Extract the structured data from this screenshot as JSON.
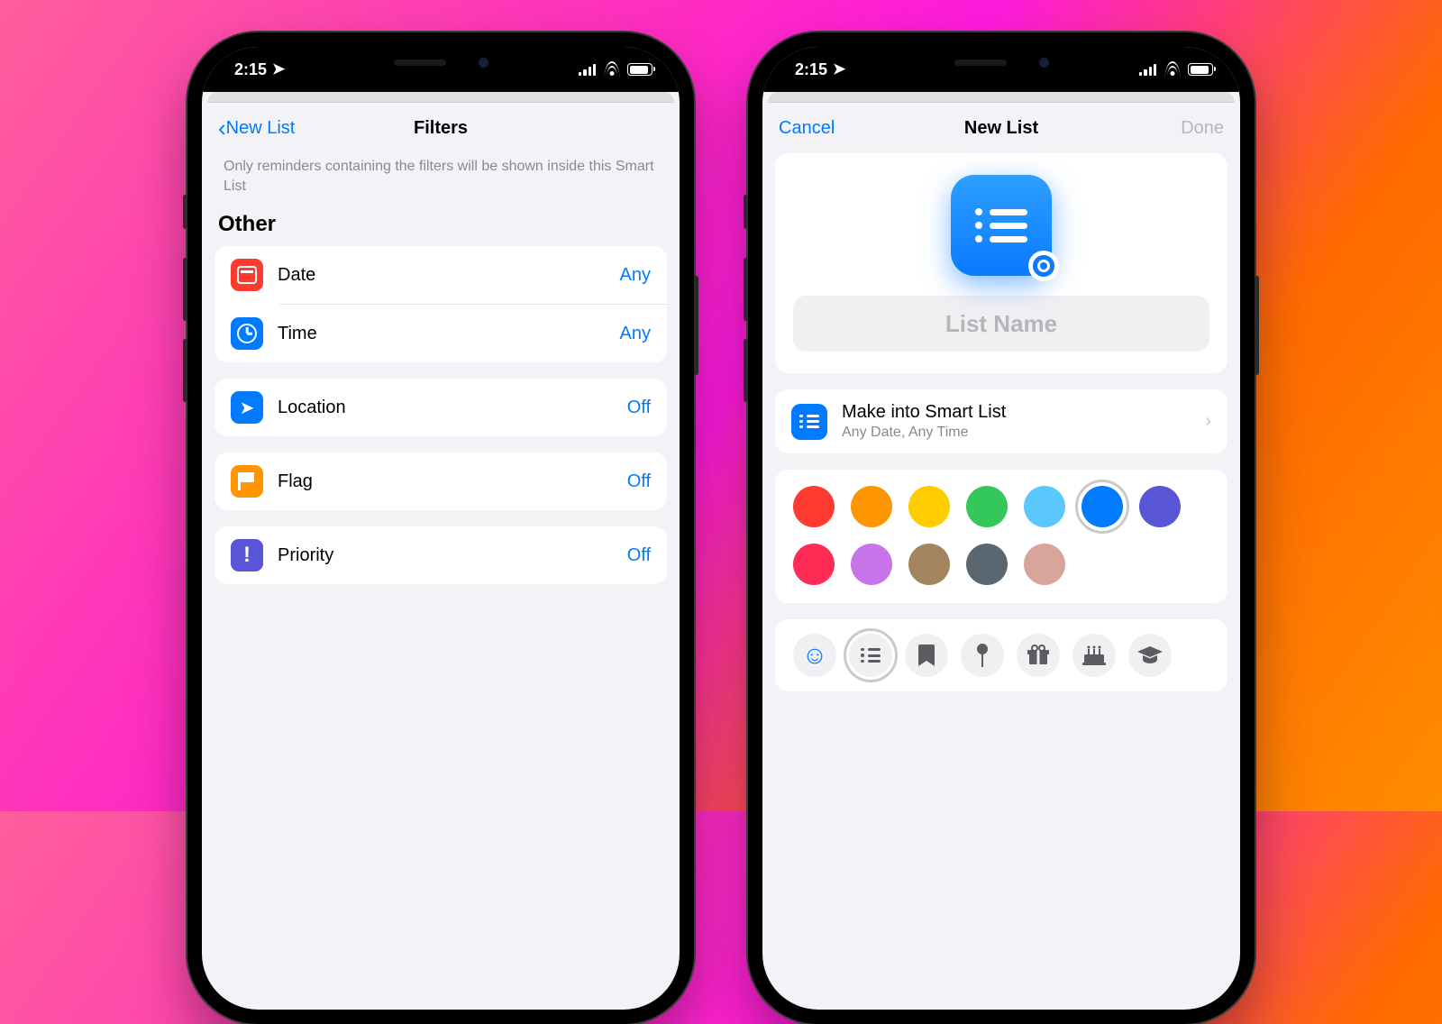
{
  "status": {
    "time": "2:15"
  },
  "left": {
    "nav": {
      "back": "New List",
      "title": "Filters"
    },
    "helper": "Only reminders containing the filters will be shown inside this Smart List",
    "section": "Other",
    "rows": {
      "date": {
        "label": "Date",
        "value": "Any"
      },
      "time": {
        "label": "Time",
        "value": "Any"
      },
      "location": {
        "label": "Location",
        "value": "Off"
      },
      "flag": {
        "label": "Flag",
        "value": "Off"
      },
      "priority": {
        "label": "Priority",
        "value": "Off"
      }
    }
  },
  "right": {
    "nav": {
      "cancel": "Cancel",
      "title": "New List",
      "done": "Done"
    },
    "name_placeholder": "List Name",
    "smart": {
      "title": "Make into Smart List",
      "subtitle": "Any Date, Any Time"
    },
    "colors": [
      "#ff3b30",
      "#ff9500",
      "#ffcc00",
      "#34c759",
      "#5ac8fa",
      "#007aff",
      "#5856d6",
      "#ff2d55",
      "#c774e8",
      "#a2845e",
      "#5b6770",
      "#d9a59a"
    ],
    "selected_color_index": 5,
    "icon_names": [
      "smiley",
      "list",
      "bookmark",
      "pin",
      "gift",
      "cake",
      "graduation"
    ],
    "selected_icon_index": 1
  }
}
